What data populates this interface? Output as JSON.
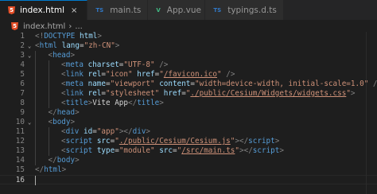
{
  "tabs": [
    {
      "label": "index.html",
      "icon": "html5-icon",
      "active": true,
      "close": "×"
    },
    {
      "label": "main.ts",
      "icon": "ts-icon",
      "active": false
    },
    {
      "label": "App.vue",
      "icon": "vue-icon",
      "active": false
    },
    {
      "label": "typings.d.ts",
      "icon": "ts-icon",
      "active": false
    }
  ],
  "tab_icons": {
    "html": "5",
    "ts": "TS",
    "vue": "V"
  },
  "breadcrumb": {
    "file": "index.html",
    "separator": "›",
    "more": "..."
  },
  "current_line": 16,
  "colors": {
    "tag": "#569cd6",
    "attr": "#9cdcfe",
    "string": "#ce9178",
    "text": "#d4d4d4",
    "punct": "#808080",
    "background": "#1e1e1e"
  },
  "lines": [
    {
      "n": "1",
      "indent": 0,
      "tokens": [
        [
          "gd",
          "<!"
        ],
        [
          "tg",
          "DOCTYPE"
        ],
        [
          "tx",
          " "
        ],
        [
          "at",
          "html"
        ],
        [
          "gd",
          ">"
        ]
      ]
    },
    {
      "n": "2",
      "indent": 0,
      "fold": true,
      "tokens": [
        [
          "gd",
          "<"
        ],
        [
          "tg",
          "html"
        ],
        [
          "tx",
          " "
        ],
        [
          "at",
          "lang"
        ],
        [
          "tx",
          "="
        ],
        [
          "st",
          "\"zh-CN\""
        ],
        [
          "gd",
          ">"
        ]
      ]
    },
    {
      "n": "3",
      "indent": 1,
      "fold": true,
      "tokens": [
        [
          "gd",
          "<"
        ],
        [
          "tg",
          "head"
        ],
        [
          "gd",
          ">"
        ]
      ]
    },
    {
      "n": "4",
      "indent": 2,
      "tokens": [
        [
          "gd",
          "<"
        ],
        [
          "tg",
          "meta"
        ],
        [
          "tx",
          " "
        ],
        [
          "at",
          "charset"
        ],
        [
          "tx",
          "="
        ],
        [
          "st",
          "\"UTF-8\""
        ],
        [
          "tx",
          " "
        ],
        [
          "gd",
          "/>"
        ]
      ]
    },
    {
      "n": "5",
      "indent": 2,
      "tokens": [
        [
          "gd",
          "<"
        ],
        [
          "tg",
          "link"
        ],
        [
          "tx",
          " "
        ],
        [
          "at",
          "rel"
        ],
        [
          "tx",
          "="
        ],
        [
          "st",
          "\"icon\""
        ],
        [
          "tx",
          " "
        ],
        [
          "at",
          "href"
        ],
        [
          "tx",
          "="
        ],
        [
          "st",
          "\""
        ],
        [
          "stul",
          "/favicon.ico"
        ],
        [
          "st",
          "\""
        ],
        [
          "tx",
          " "
        ],
        [
          "gd",
          "/>"
        ]
      ]
    },
    {
      "n": "6",
      "indent": 2,
      "tokens": [
        [
          "gd",
          "<"
        ],
        [
          "tg",
          "meta"
        ],
        [
          "tx",
          " "
        ],
        [
          "at",
          "name"
        ],
        [
          "tx",
          "="
        ],
        [
          "st",
          "\"viewport\""
        ],
        [
          "tx",
          " "
        ],
        [
          "at",
          "content"
        ],
        [
          "tx",
          "="
        ],
        [
          "st",
          "\"width=device-width, initial-scale=1.0\""
        ],
        [
          "tx",
          " "
        ],
        [
          "gd",
          "/>"
        ]
      ]
    },
    {
      "n": "7",
      "indent": 2,
      "tokens": [
        [
          "gd",
          "<"
        ],
        [
          "tg",
          "link"
        ],
        [
          "tx",
          " "
        ],
        [
          "at",
          "rel"
        ],
        [
          "tx",
          "="
        ],
        [
          "st",
          "\"stylesheet\""
        ],
        [
          "tx",
          " "
        ],
        [
          "at",
          "href"
        ],
        [
          "tx",
          "="
        ],
        [
          "st",
          "\""
        ],
        [
          "stul",
          "./public/Cesium/Widgets/widgets.css"
        ],
        [
          "st",
          "\""
        ],
        [
          "gd",
          ">"
        ]
      ]
    },
    {
      "n": "8",
      "indent": 2,
      "tokens": [
        [
          "gd",
          "<"
        ],
        [
          "tg",
          "title"
        ],
        [
          "gd",
          ">"
        ],
        [
          "tx",
          "Vite App"
        ],
        [
          "gd",
          "</"
        ],
        [
          "tg",
          "title"
        ],
        [
          "gd",
          ">"
        ]
      ]
    },
    {
      "n": "9",
      "indent": 1,
      "tokens": [
        [
          "gd",
          "</"
        ],
        [
          "tg",
          "head"
        ],
        [
          "gd",
          ">"
        ]
      ]
    },
    {
      "n": "10",
      "indent": 1,
      "fold": true,
      "tokens": [
        [
          "gd",
          "<"
        ],
        [
          "tg",
          "body"
        ],
        [
          "gd",
          ">"
        ]
      ]
    },
    {
      "n": "11",
      "indent": 2,
      "tokens": [
        [
          "gd",
          "<"
        ],
        [
          "tg",
          "div"
        ],
        [
          "tx",
          " "
        ],
        [
          "at",
          "id"
        ],
        [
          "tx",
          "="
        ],
        [
          "st",
          "\"app\""
        ],
        [
          "gd",
          "></"
        ],
        [
          "tg",
          "div"
        ],
        [
          "gd",
          ">"
        ]
      ]
    },
    {
      "n": "12",
      "indent": 2,
      "tokens": [
        [
          "gd",
          "<"
        ],
        [
          "tg",
          "script"
        ],
        [
          "tx",
          " "
        ],
        [
          "at",
          "src"
        ],
        [
          "tx",
          "="
        ],
        [
          "st",
          "\""
        ],
        [
          "stul",
          "./public/Cesium/Cesium.js"
        ],
        [
          "st",
          "\""
        ],
        [
          "gd",
          "></"
        ],
        [
          "tg",
          "script"
        ],
        [
          "gd",
          ">"
        ]
      ]
    },
    {
      "n": "13",
      "indent": 2,
      "tokens": [
        [
          "gd",
          "<"
        ],
        [
          "tg",
          "script"
        ],
        [
          "tx",
          " "
        ],
        [
          "at",
          "type"
        ],
        [
          "tx",
          "="
        ],
        [
          "st",
          "\"module\""
        ],
        [
          "tx",
          " "
        ],
        [
          "at",
          "src"
        ],
        [
          "tx",
          "="
        ],
        [
          "st",
          "\""
        ],
        [
          "stul",
          "/src/main.ts"
        ],
        [
          "st",
          "\""
        ],
        [
          "gd",
          "></"
        ],
        [
          "tg",
          "script"
        ],
        [
          "gd",
          ">"
        ]
      ]
    },
    {
      "n": "14",
      "indent": 1,
      "tokens": [
        [
          "gd",
          "</"
        ],
        [
          "tg",
          "body"
        ],
        [
          "gd",
          ">"
        ]
      ]
    },
    {
      "n": "15",
      "indent": 0,
      "tokens": [
        [
          "gd",
          "</"
        ],
        [
          "tg",
          "html"
        ],
        [
          "gd",
          ">"
        ]
      ]
    },
    {
      "n": "16",
      "indent": 0,
      "tokens": []
    }
  ]
}
